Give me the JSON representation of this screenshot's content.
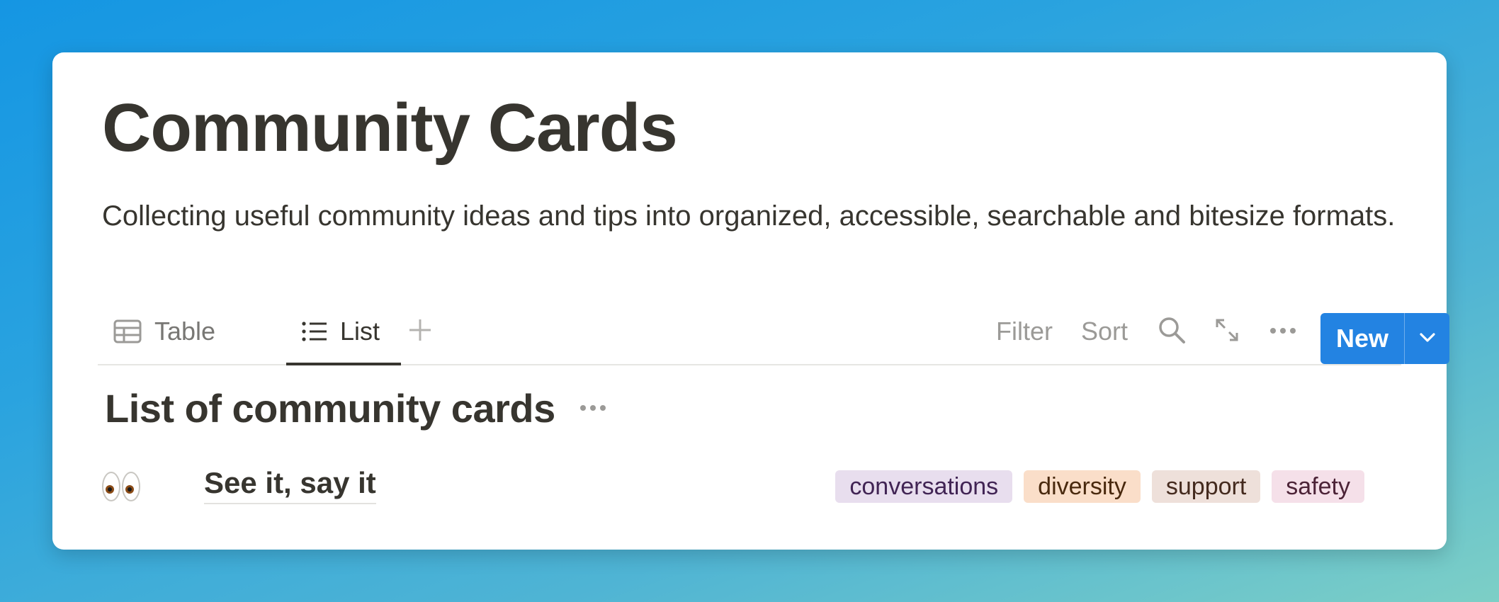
{
  "page": {
    "title": "Community Cards",
    "description": "Collecting useful community ideas and tips into organized, accessible, searchable and bitesize formats."
  },
  "views": {
    "tabs": [
      {
        "label": "Table",
        "icon": "table-icon",
        "active": false
      },
      {
        "label": "List",
        "icon": "list-icon",
        "active": true
      }
    ],
    "add_icon": "plus-icon"
  },
  "toolbar": {
    "filter_label": "Filter",
    "sort_label": "Sort",
    "search_icon": "search-icon",
    "expand_icon": "expand-icon",
    "more_icon": "more-icon",
    "new_label": "New",
    "new_dropdown_icon": "chevron-down-icon",
    "accent_color": "#2383e2"
  },
  "section": {
    "title": "List of community cards",
    "more_icon": "more-icon"
  },
  "items": [
    {
      "emoji": "eyes-emoji",
      "title": "See it, say it",
      "tags": [
        {
          "label": "conversations",
          "bg": "#e8deee",
          "color": "#412454"
        },
        {
          "label": "diversity",
          "bg": "#fadec9",
          "color": "#49290e"
        },
        {
          "label": "support",
          "bg": "#eee0da",
          "color": "#442a1e"
        },
        {
          "label": "safety",
          "bg": "#f5e0e9",
          "color": "#4c2337"
        }
      ]
    }
  ]
}
